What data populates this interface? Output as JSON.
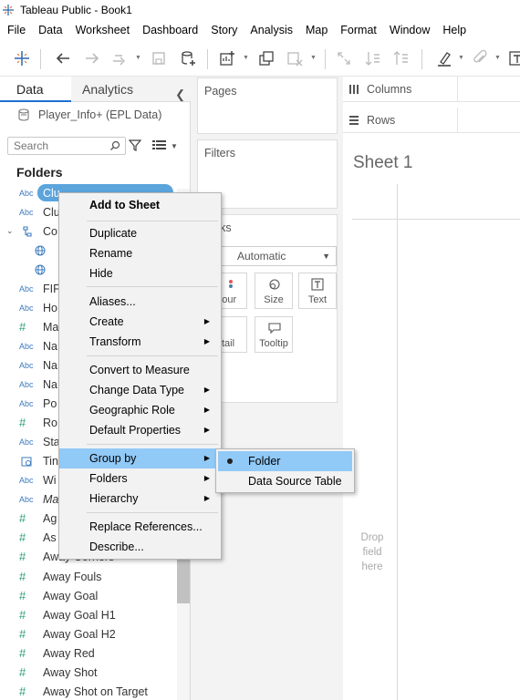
{
  "window": {
    "title": "Tableau Public - Book1"
  },
  "menubar": [
    "File",
    "Data",
    "Worksheet",
    "Dashboard",
    "Story",
    "Analysis",
    "Map",
    "Format",
    "Window",
    "Help"
  ],
  "left": {
    "tab_data": "Data",
    "tab_analytics": "Analytics",
    "datasource": "Player_Info+ (EPL Data)",
    "search_placeholder": "Search",
    "folders_heading": "Folders",
    "fields": [
      {
        "type": "Abc",
        "name": "Clu",
        "selected": true
      },
      {
        "type": "Abc",
        "name": "Clu"
      },
      {
        "type": "hier",
        "name": "Co"
      },
      {
        "type": "globe",
        "name": ""
      },
      {
        "type": "globe",
        "name": ""
      },
      {
        "type": "Abc",
        "name": "FIF"
      },
      {
        "type": "Abc",
        "name": "Ho"
      },
      {
        "type": "#",
        "name": "Ma"
      },
      {
        "type": "Abc",
        "name": "Na"
      },
      {
        "type": "Abc",
        "name": "Na"
      },
      {
        "type": "Abc",
        "name": "Na"
      },
      {
        "type": "Abc",
        "name": "Po"
      },
      {
        "type": "#",
        "name": "Ro"
      },
      {
        "type": "Abc",
        "name": "Sta"
      },
      {
        "type": "date",
        "name": "Tin"
      },
      {
        "type": "Abc",
        "name": "Wi"
      },
      {
        "type": "Abc",
        "name": "Ma"
      },
      {
        "type": "#",
        "name": "Ag"
      },
      {
        "type": "#",
        "name": "As"
      },
      {
        "type": "#",
        "name": "Away Corners"
      },
      {
        "type": "#",
        "name": "Away Fouls"
      },
      {
        "type": "#",
        "name": "Away Goal"
      },
      {
        "type": "#",
        "name": "Away Goal H1"
      },
      {
        "type": "#",
        "name": "Away Goal H2"
      },
      {
        "type": "#",
        "name": "Away Red"
      },
      {
        "type": "#",
        "name": "Away Shot"
      },
      {
        "type": "#",
        "name": "Away Shot on Target"
      }
    ]
  },
  "middle": {
    "pages": "Pages",
    "filters": "Filters",
    "marks_header": "rks",
    "mark_type": "Automatic",
    "buttons": {
      "colour": "lour",
      "size": "Size",
      "text": "Text",
      "detail": "tail",
      "tooltip": "Tooltip"
    }
  },
  "shelves": {
    "columns": "Columns",
    "rows": "Rows"
  },
  "sheet": {
    "title": "Sheet 1",
    "drop_l1": "Drop",
    "drop_l2": "field",
    "drop_l3": "here"
  },
  "context_menu": {
    "items": [
      "Add to Sheet",
      "Duplicate",
      "Rename",
      "Hide",
      "Aliases...",
      "Create",
      "Transform",
      "Convert to Measure",
      "Change Data Type",
      "Geographic Role",
      "Default Properties",
      "Group by",
      "Folders",
      "Hierarchy",
      "Replace References...",
      "Describe..."
    ]
  },
  "submenu": {
    "items": [
      "Folder",
      "Data Source Table"
    ]
  }
}
